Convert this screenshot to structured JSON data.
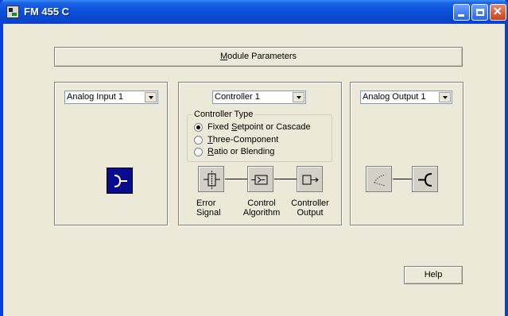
{
  "window": {
    "title": "FM 455 C"
  },
  "module_button": {
    "label_pre": "",
    "label_ul": "M",
    "label_post": "odule Parameters"
  },
  "input_panel": {
    "selector_value": "Analog Input 1"
  },
  "controller_panel": {
    "selector_value": "Controller 1",
    "controller_type": {
      "label": "Controller Type",
      "options": [
        {
          "pre": "Fixed ",
          "ul": "S",
          "post": "etpoint or Cascade",
          "selected": true
        },
        {
          "pre": "",
          "ul": "T",
          "post": "hree-Component",
          "selected": false
        },
        {
          "pre": "",
          "ul": "R",
          "post": "atio or Blending",
          "selected": false
        }
      ]
    },
    "blocks": [
      {
        "line1": "Error",
        "line2": "Signal"
      },
      {
        "line1": "Control",
        "line2": "Algorithm"
      },
      {
        "line1": "Controller",
        "line2": "Output"
      }
    ]
  },
  "output_panel": {
    "selector_value": "Analog Output 1"
  },
  "help_button": {
    "label": "Help"
  },
  "colors": {
    "titlebar": "#0a4fd8",
    "window_bg": "#ece9d8",
    "input_icon_bg": "#0b0b8f"
  }
}
